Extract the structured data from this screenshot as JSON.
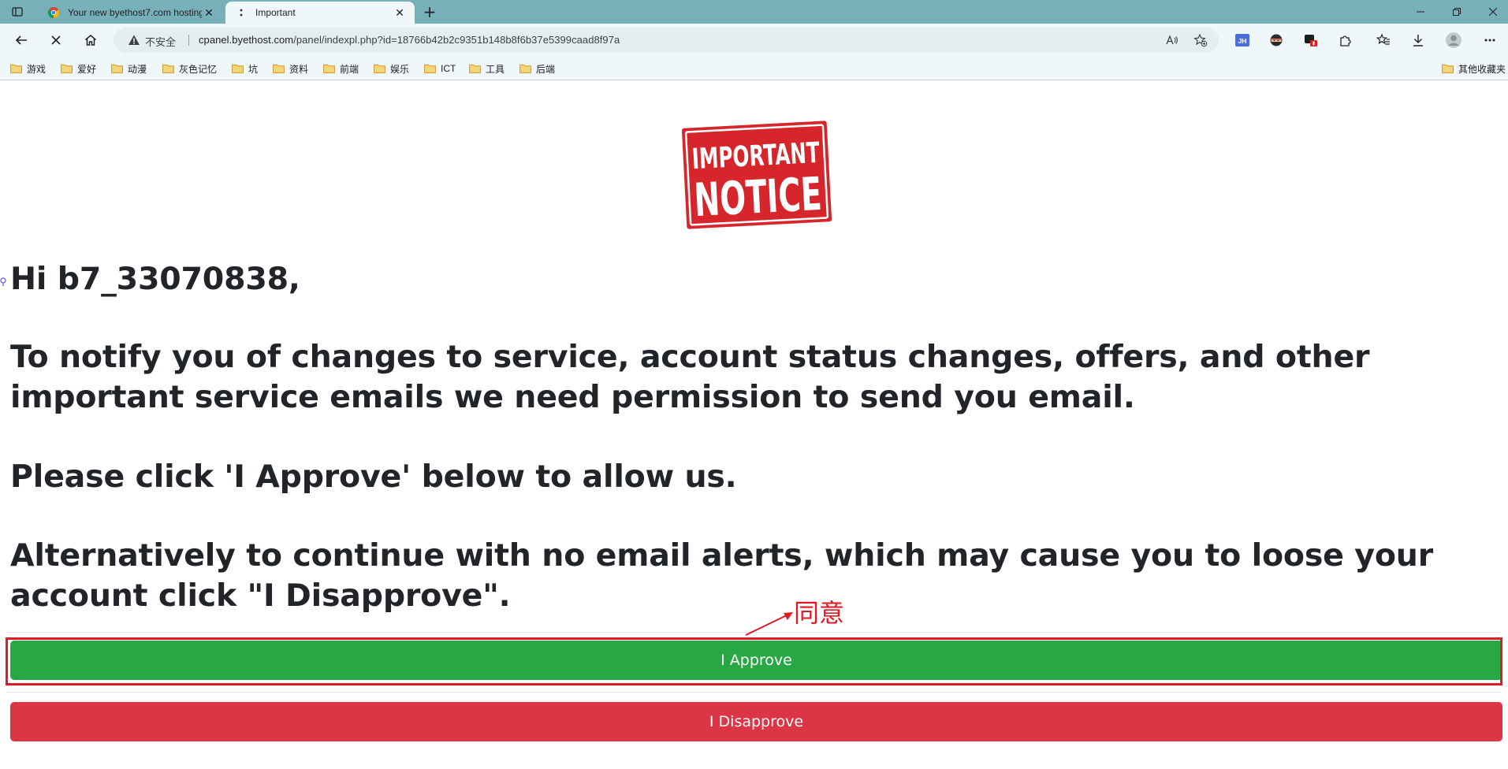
{
  "browser": {
    "tabs": [
      {
        "title": "Your new byethost7.com hosting",
        "active": false
      },
      {
        "title": "Important",
        "active": true
      }
    ],
    "address": {
      "security_label": "不安全",
      "url_host": "cpanel.byethost.com",
      "url_path": "/panel/indexpl.php?id=18766b42b2c9351b148b8f6b37e5399caad8f97a"
    },
    "extensions": {
      "jh_badge": "JH"
    },
    "bookmarks": [
      "游戏",
      "爱好",
      "动漫",
      "灰色记忆",
      "坑",
      "资料",
      "前端",
      "娱乐",
      "ICT",
      "工具",
      "后端"
    ],
    "other_bookmarks": "其他收藏夹"
  },
  "page": {
    "stamp_lines": [
      "IMPORTANT",
      "NOTICE"
    ],
    "greeting": "Hi b7_33070838,",
    "paragraphs": [
      "To notify you of changes to service, account status changes, offers, and other important service emails we need permission to send you email.",
      "Please click 'I Approve' below to allow us.",
      "Alternatively to continue with no email alerts, which may cause you to loose your account click \"I Disapprove\"."
    ],
    "approve_label": "I Approve",
    "disapprove_label": "I Disapprove"
  },
  "annotation": {
    "label": "同意",
    "color": "#e01923"
  },
  "colors": {
    "approve": "#28a745",
    "disapprove": "#dc3545",
    "stamp": "#d7262b",
    "chrome": "#78b0ba"
  }
}
